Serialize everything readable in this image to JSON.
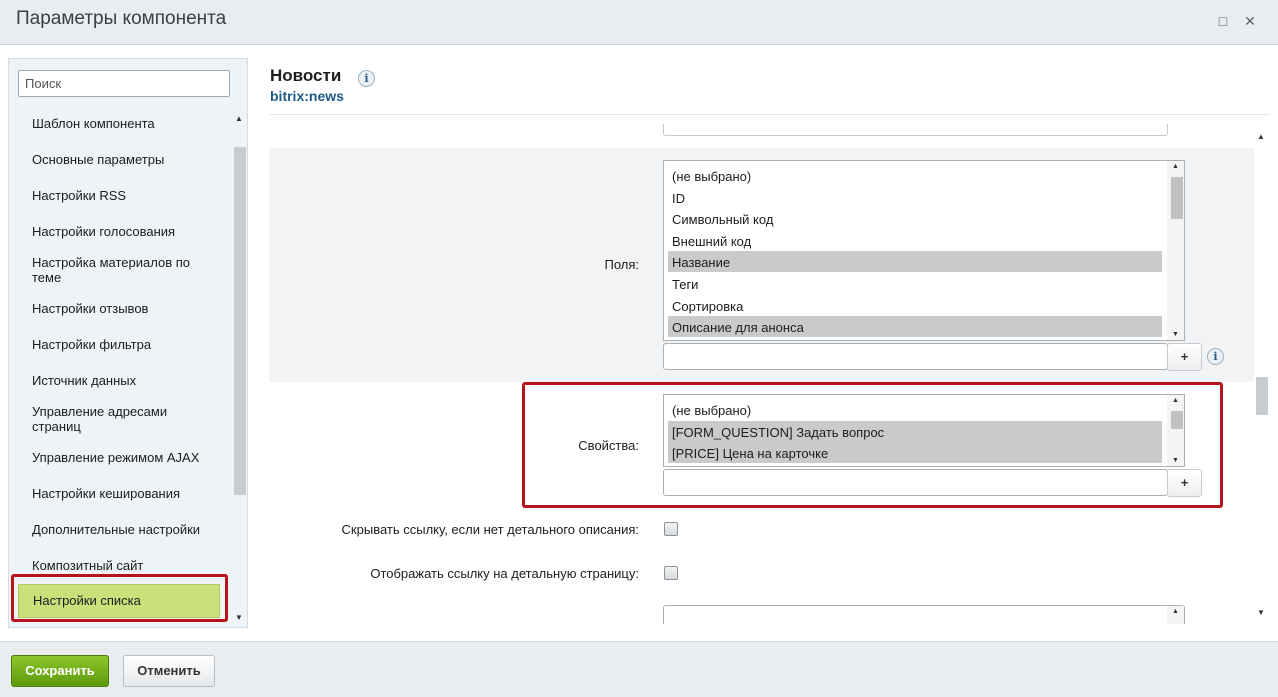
{
  "window": {
    "title": "Параметры компонента",
    "maximize_glyph": "□",
    "close_glyph": "✕"
  },
  "sidebar": {
    "search_placeholder": "Поиск",
    "items": [
      {
        "label": "Шаблон компонента"
      },
      {
        "label": "Основные параметры"
      },
      {
        "label": "Настройки RSS"
      },
      {
        "label": "Настройки голосования"
      },
      {
        "label": "Настройка материалов по теме"
      },
      {
        "label": "Настройки отзывов"
      },
      {
        "label": "Настройки фильтра"
      },
      {
        "label": "Источник данных"
      },
      {
        "label": "Управление адресами страниц"
      },
      {
        "label": "Управление режимом AJAX"
      },
      {
        "label": "Настройки кеширования"
      },
      {
        "label": "Дополнительные настройки"
      },
      {
        "label": "Композитный сайт"
      },
      {
        "label": "Настройки списка",
        "active": true
      }
    ],
    "active_color": "#cce07a"
  },
  "component": {
    "title": "Новости",
    "code": "bitrix:news",
    "info_glyph": "i"
  },
  "form": {
    "fields": {
      "label": "Поля:",
      "options": [
        {
          "text": "(не выбрано)",
          "selected": false
        },
        {
          "text": "ID",
          "selected": false
        },
        {
          "text": "Символьный код",
          "selected": false
        },
        {
          "text": "Внешний код",
          "selected": false
        },
        {
          "text": "Название",
          "selected": true
        },
        {
          "text": "Теги",
          "selected": false
        },
        {
          "text": "Сортировка",
          "selected": false
        },
        {
          "text": "Описание для анонса",
          "selected": true
        }
      ],
      "add_label": "+",
      "input_value": ""
    },
    "properties": {
      "label": "Свойства:",
      "options": [
        {
          "text": "(не выбрано)",
          "selected": false
        },
        {
          "text": "[FORM_QUESTION] Задать вопрос",
          "selected": true
        },
        {
          "text": "[PRICE] Цена на карточке",
          "selected": true
        }
      ],
      "add_label": "+",
      "input_value": ""
    },
    "hide_link_label": "Скрывать ссылку, если нет детального описания:",
    "show_link_label": "Отображать ссылку на детальную страницу:"
  },
  "footer": {
    "save_label": "Сохранить",
    "cancel_label": "Отменить"
  },
  "colors": {
    "highlight_border": "#b5141b",
    "save_button": "#6aa514",
    "selected_option": "#c8cacc"
  }
}
